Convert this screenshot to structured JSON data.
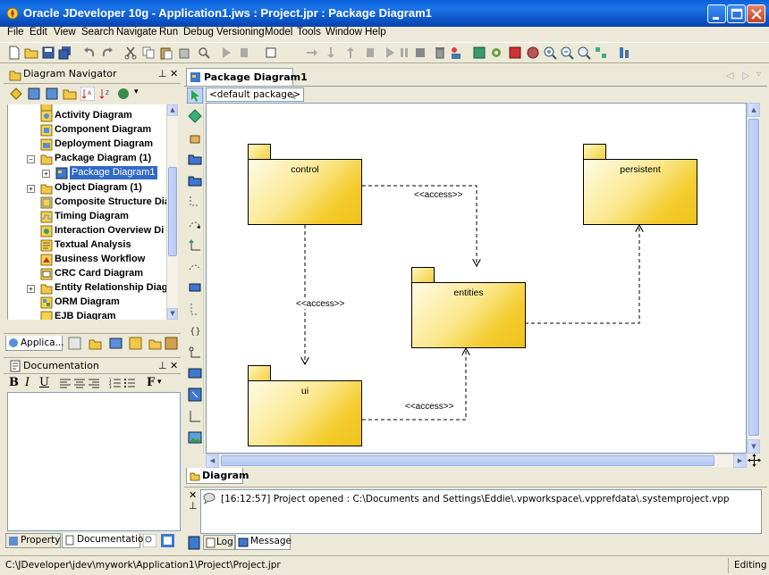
{
  "window": {
    "title": "Oracle JDeveloper 10g - Application1.jws : Project.jpr : Package Diagram1"
  },
  "menu": [
    "File",
    "Edit",
    "View",
    "Search",
    "Navigate",
    "Run",
    "Debug",
    "Versioning",
    "Model",
    "Tools",
    "Window",
    "Help"
  ],
  "navigator": {
    "title": "Diagram Navigator",
    "items": [
      {
        "label": "Activity Diagram",
        "expandable": false
      },
      {
        "label": "Component Diagram",
        "expandable": false
      },
      {
        "label": "Deployment Diagram",
        "expandable": false
      },
      {
        "label": "Package Diagram (1)",
        "expandable": true,
        "expanded": true
      },
      {
        "label": "Package Diagram1",
        "child": true,
        "selected": true
      },
      {
        "label": "Object Diagram (1)",
        "expandable": true
      },
      {
        "label": "Composite Structure Dia",
        "expandable": false
      },
      {
        "label": "Timing Diagram",
        "expandable": false
      },
      {
        "label": "Interaction Overview Di",
        "expandable": false
      },
      {
        "label": "Textual Analysis",
        "expandable": false
      },
      {
        "label": "Business Workflow",
        "expandable": false
      },
      {
        "label": "CRC Card Diagram",
        "expandable": false
      },
      {
        "label": "Entity Relationship Diag",
        "expandable": true
      },
      {
        "label": "ORM Diagram",
        "expandable": false
      },
      {
        "label": "EJB Diagram",
        "expandable": false
      }
    ],
    "bottom_tab": "Applica..."
  },
  "documentation": {
    "title": "Documentation",
    "format_buttons": [
      "B",
      "I",
      "U"
    ],
    "tabs": [
      "Property",
      "Documentation"
    ]
  },
  "editor": {
    "tab": "Package Diagram1",
    "breadcrumb": "<default package>",
    "bottom_tab": "Diagram",
    "packages": [
      {
        "name": "control"
      },
      {
        "name": "persistent"
      },
      {
        "name": "entities"
      },
      {
        "name": "ui"
      }
    ],
    "dependencies": [
      {
        "label": "<<access>>"
      },
      {
        "label": "<<access>>"
      },
      {
        "label": "<<access>>"
      }
    ]
  },
  "message_panel": {
    "message": "[16:12:57]  Project opened : C:\\Documents and Settings\\Eddie\\.vpworkspace\\.vpprefdata\\.systemproject.vpp",
    "tabs": [
      "Log",
      "Message"
    ]
  },
  "status": {
    "path": "C:\\JDeveloper\\jdev\\mywork\\Application1\\Project\\Project.jpr",
    "mode": "Editing"
  }
}
